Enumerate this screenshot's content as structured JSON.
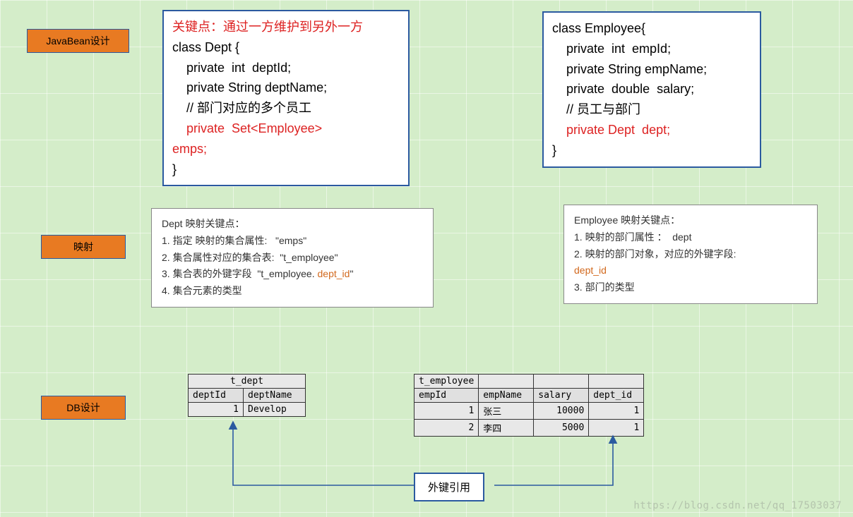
{
  "labels": {
    "javabean": "JavaBean设计",
    "mapping": "映射",
    "db": "DB设计"
  },
  "dept_code": {
    "keypoint": "关键点：通过一方维护到另外一方",
    "line1": "class Dept {",
    "line2": "    private  int  deptId;",
    "line3": "    private String deptName;",
    "line4": "    // 部门对应的多个员工",
    "line5a": "    private  Set<Employee> ",
    "line5b": "emps;",
    "line6": "}"
  },
  "emp_code": {
    "line1": "class Employee{",
    "line2": "    private  int  empId;",
    "line3": "    private String empName;",
    "line4": "    private  double  salary;",
    "line5": "    // 员工与部门",
    "line6": "    private Dept  dept;",
    "line7": "}"
  },
  "dept_info": {
    "l1": "Dept 映射关键点：",
    "l2a": "1. 指定 映射的集合属性:   \"",
    "l2b": "emps",
    "l2c": "\"",
    "l3a": "2. 集合属性对应的集合表:  \"",
    "l3b": "t_employee",
    "l3c": "\"",
    "l4a": "3. 集合表的外键字段  \"",
    "l4b": "t_employee. ",
    "l4c": "dept_id",
    "l4d": "\"",
    "l5": "4. 集合元素的类型"
  },
  "emp_info": {
    "l1": "Employee 映射关键点：",
    "l2a": "1. 映射的部门属性 ：  ",
    "l2b": "dept",
    "l3": "2. 映射的部门对象，对应的外键字段: ",
    "l3b": "dept_id",
    "l4": "3. 部门的类型"
  },
  "t_dept": {
    "name": "t_dept",
    "cols": {
      "c1": "deptId",
      "c2": "deptName"
    },
    "row1": {
      "c1": "1",
      "c2": "Develop"
    }
  },
  "t_employee": {
    "name": "t_employee",
    "cols": {
      "c1": "empId",
      "c2": "empName",
      "c3": "salary",
      "c4": "dept_id"
    },
    "row1": {
      "c1": "1",
      "c2": "张三",
      "c3": "10000",
      "c4": "1"
    },
    "row2": {
      "c1": "2",
      "c2": "李四",
      "c3": "5000",
      "c4": "1"
    }
  },
  "fk_label": "外键引用",
  "watermark": "https://blog.csdn.net/qq_17503037"
}
